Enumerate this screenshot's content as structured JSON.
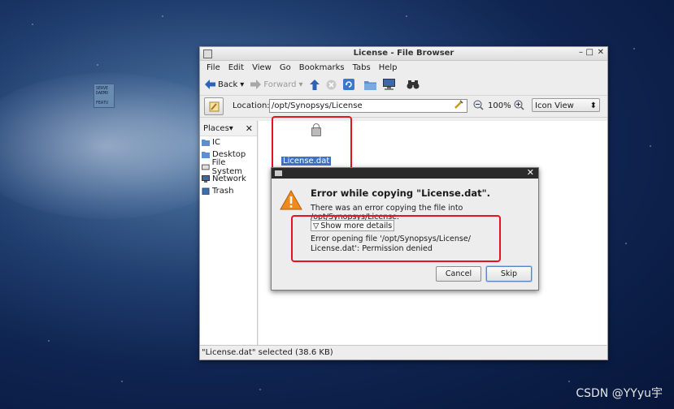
{
  "window": {
    "title": "License - File Browser",
    "controls": {
      "minimize": "–",
      "maximize": "□",
      "close": "✕"
    }
  },
  "menubar": [
    "File",
    "Edit",
    "View",
    "Go",
    "Bookmarks",
    "Tabs",
    "Help"
  ],
  "toolbar": {
    "back": "Back",
    "forward": "Forward",
    "dropdown_glyph": "▾"
  },
  "location": {
    "label": "Location:",
    "value": "/opt/Synopsys/License",
    "zoom": "100%",
    "view_mode": "Icon View"
  },
  "sidebar": {
    "header": "Places",
    "items": [
      {
        "label": "IC",
        "icon": "folder-icon"
      },
      {
        "label": "Desktop",
        "icon": "folder-icon"
      },
      {
        "label": "File System",
        "icon": "drive-icon"
      },
      {
        "label": "Network",
        "icon": "network-icon"
      },
      {
        "label": "Trash",
        "icon": "trash-icon"
      }
    ]
  },
  "file": {
    "name": "License.dat",
    "thumb_lines": [
      "SERVE",
      "DAEMO",
      "",
      "FEATU"
    ]
  },
  "status": "\"License.dat\" selected (38.6 KB)",
  "dialog": {
    "heading": "Error while copying \"License.dat\".",
    "message": "There was an error copying the file into /opt/Synopsys/License.",
    "details_toggle": "Show more details",
    "details_line1": "Error opening file '/opt/Synopsys/License/",
    "details_line2": "License.dat': Permission denied",
    "cancel": "Cancel",
    "skip": "Skip"
  },
  "watermark": "CSDN @YYyu宇",
  "colors": {
    "highlight": "#e3141c",
    "selection": "#3d73c2",
    "warning": "#f08a1c"
  }
}
